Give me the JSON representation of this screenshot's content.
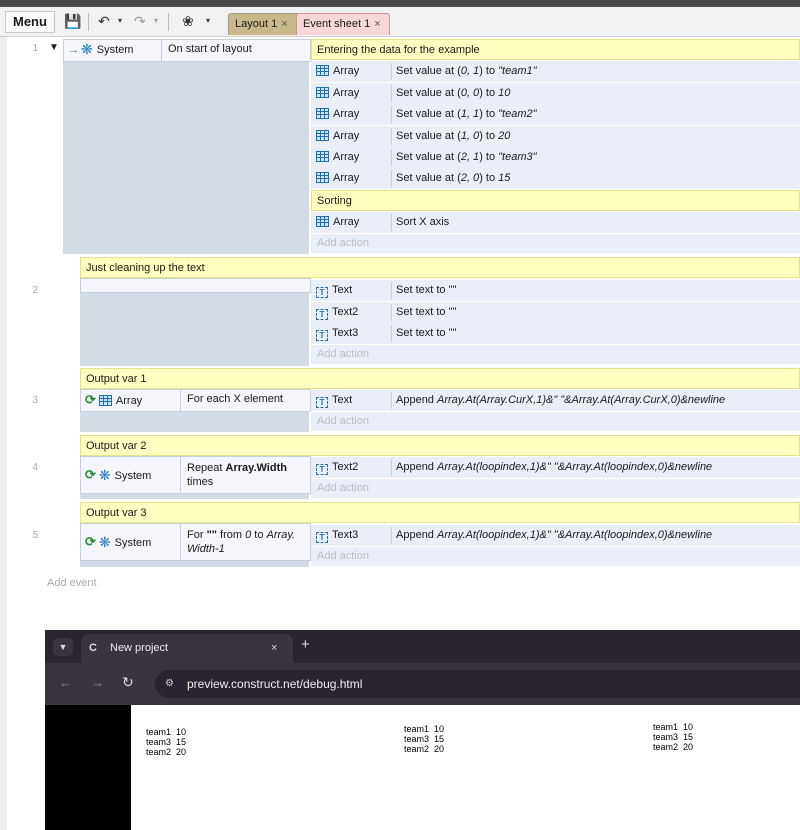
{
  "toolbar": {
    "menu_label": "Menu",
    "tab_layout": "Layout 1",
    "tab_sheet": "Event sheet 1",
    "tab_close": "×"
  },
  "events": [
    {
      "number": "1"
    },
    {
      "number": "2"
    },
    {
      "number": "3"
    },
    {
      "number": "4"
    },
    {
      "number": "5"
    }
  ],
  "event1": {
    "cond_object": "System",
    "cond_text": "On start of layout",
    "comment1": "Entering the data for the example",
    "actions": [
      {
        "object": "Array",
        "text_pre": "Set value at (",
        "text_it": "0, 1",
        "text_mid": ") to ",
        "text_val": "\"team1\""
      },
      {
        "object": "Array",
        "text_pre": "Set value at (",
        "text_it": "0, 0",
        "text_mid": ") to ",
        "text_val": "10"
      },
      {
        "object": "Array",
        "text_pre": "Set value at (",
        "text_it": "1, 1",
        "text_mid": ") to ",
        "text_val": "\"team2\""
      },
      {
        "object": "Array",
        "text_pre": "Set value at (",
        "text_it": "1, 0",
        "text_mid": ") to ",
        "text_val": "20"
      },
      {
        "object": "Array",
        "text_pre": "Set value at (",
        "text_it": "2, 1",
        "text_mid": ") to ",
        "text_val": "\"team3\""
      },
      {
        "object": "Array",
        "text_pre": "Set value at (",
        "text_it": "2, 0",
        "text_mid": ") to ",
        "text_val": "15"
      }
    ],
    "comment2": "Sorting",
    "sort_object": "Array",
    "sort_text": "Sort X axis",
    "add_action": "Add action"
  },
  "event2": {
    "comment": "Just cleaning up the text",
    "actions": [
      {
        "object": "Text",
        "text": "Set text to \"\""
      },
      {
        "object": "Text2",
        "text": "Set text to \"\""
      },
      {
        "object": "Text3",
        "text": "Set text to \"\""
      }
    ],
    "add_action": "Add action"
  },
  "event3": {
    "comment": "Output var 1",
    "cond_object": "Array",
    "cond_text": "For each X element",
    "act_object": "Text",
    "act_pre": "Append ",
    "act_it": "Array.At(Array.CurX,1)&\"   \"&Array.At(Array.CurX,0)&newline",
    "add_action": "Add action"
  },
  "event4": {
    "comment": "Output var 2",
    "cond_object": "System",
    "cond_pre": "Repeat ",
    "cond_bold": "Array.Width",
    "cond_post": "times",
    "act_object": "Text2",
    "act_pre": "Append ",
    "act_it": "Array.At(loopindex,1)&\"   \"&Array.At(loopindex,0)&newline",
    "add_action": "Add action"
  },
  "event5": {
    "comment": "Output var 3",
    "cond_object": "System",
    "cond_pre": "For ",
    "cond_bold": "\"\"",
    "cond_mid": " from ",
    "cond_it1": "0",
    "cond_to": " to ",
    "cond_it2": "Array.",
    "cond_it3": "Width-1",
    "act_object": "Text3",
    "act_pre": "Append ",
    "act_it": "Array.At(loopindex,1)&\"   \"&Array.At(loopindex,0)&newline",
    "add_action": "Add action"
  },
  "add_event": "Add event",
  "browser": {
    "tab_title": "New project",
    "tab_close": "×",
    "new_tab": "+",
    "url": "preview.construct.net/debug.html",
    "outputs": [
      [
        "team1  10",
        "team3  15",
        "team2  20"
      ],
      [
        "team1  10",
        "team3  15",
        "team2  20"
      ],
      [
        "team1  10",
        "team3  15",
        "team2  20"
      ]
    ]
  }
}
